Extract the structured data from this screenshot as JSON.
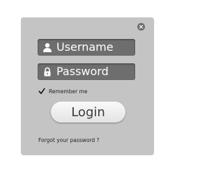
{
  "login_form": {
    "username_placeholder": "Username",
    "password_placeholder": "Password",
    "remember_label": "Remember me",
    "remember_checked": true,
    "login_label": "Login",
    "forgot_label": "Forgot your password ?",
    "icons": {
      "close": "close-icon",
      "username": "user-icon",
      "password": "lock-icon",
      "checkbox": "checkmark-icon"
    },
    "colors": {
      "panel": "#c4c4c4",
      "field": "#6e6e6e",
      "field_text": "#ffffff",
      "button": "#eeeeee",
      "close": "#6f6f6f"
    }
  }
}
